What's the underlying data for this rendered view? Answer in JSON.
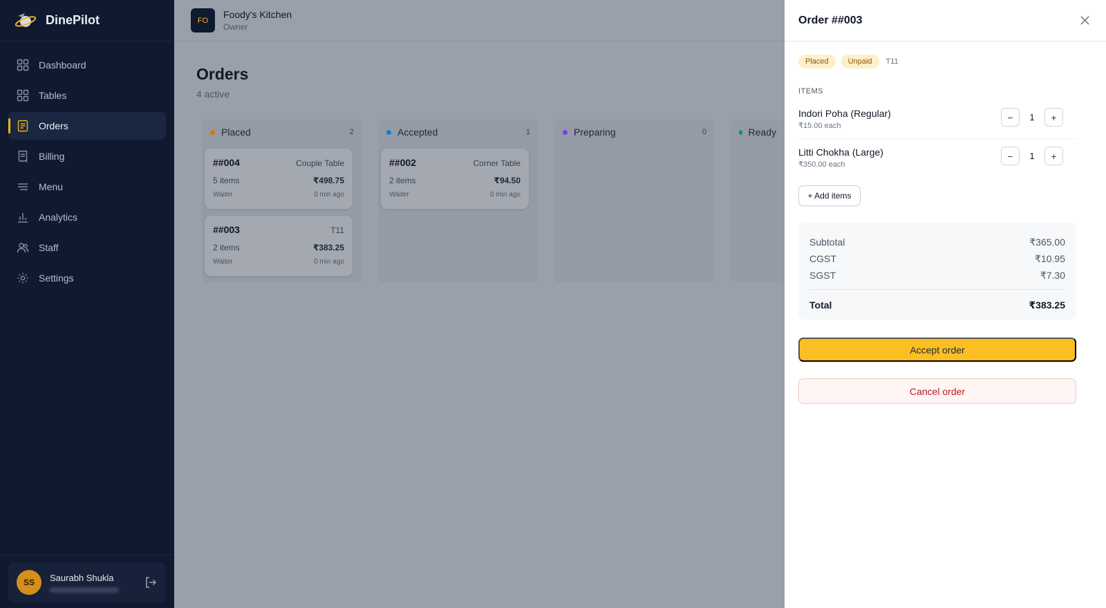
{
  "brand": {
    "name": "DinePilot",
    "logo_icon": "planet-logo-icon"
  },
  "sidebar": {
    "items": [
      {
        "label": "Dashboard",
        "icon": "grid-icon"
      },
      {
        "label": "Tables",
        "icon": "grid-icon"
      },
      {
        "label": "Orders",
        "icon": "clipboard-icon",
        "active": true
      },
      {
        "label": "Billing",
        "icon": "receipt-icon"
      },
      {
        "label": "Menu",
        "icon": "menu-lines-icon"
      },
      {
        "label": "Analytics",
        "icon": "bar-chart-icon"
      },
      {
        "label": "Staff",
        "icon": "users-icon"
      },
      {
        "label": "Settings",
        "icon": "gear-icon"
      }
    ],
    "user": {
      "initials": "SS",
      "name": "Saurabh Shukla"
    }
  },
  "topbar": {
    "org_initials": "FO",
    "org_name": "Foody's Kitchen",
    "org_role": "Owner"
  },
  "main": {
    "title": "Orders",
    "subtitle": "4 active",
    "columns": [
      {
        "title": "Placed",
        "count": "2",
        "color": "#d97706"
      },
      {
        "title": "Accepted",
        "count": "1",
        "color": "#0284c7"
      },
      {
        "title": "Preparing",
        "count": "0",
        "color": "#7c3aed"
      },
      {
        "title": "Ready",
        "count": "",
        "color": "#059669"
      }
    ],
    "cards": [
      {
        "id": "##004",
        "table": "Couple Table",
        "items": "5 items",
        "price": "₹498.75",
        "by": "Waiter",
        "time": "0 min ago"
      },
      {
        "id": "##003",
        "table": "T11",
        "items": "2 items",
        "price": "₹383.25",
        "by": "Waiter",
        "time": "0 min ago"
      },
      {
        "id": "##002",
        "table": "Corner Table",
        "items": "2 items",
        "price": "₹94.50",
        "by": "Waiter",
        "time": "0 min ago"
      }
    ]
  },
  "drawer": {
    "title": "Order ##003",
    "badges": [
      "Placed",
      "Unpaid"
    ],
    "table": "T11",
    "items_label": "ITEMS",
    "items": [
      {
        "name": "Indori Poha (Regular)",
        "each": "₹15.00 each",
        "qty": "1"
      },
      {
        "name": "Litti Chokha (Large)",
        "each": "₹350.00 each",
        "qty": "1"
      }
    ],
    "add_items_label": "+ Add items",
    "totals": {
      "subtotal_label": "Subtotal",
      "subtotal": "₹365.00",
      "cgst_label": "CGST",
      "cgst": "₹10.95",
      "sgst_label": "SGST",
      "sgst": "₹7.30",
      "total_label": "Total",
      "total": "₹383.25"
    },
    "accept_label": "Accept order",
    "cancel_label": "Cancel order"
  }
}
